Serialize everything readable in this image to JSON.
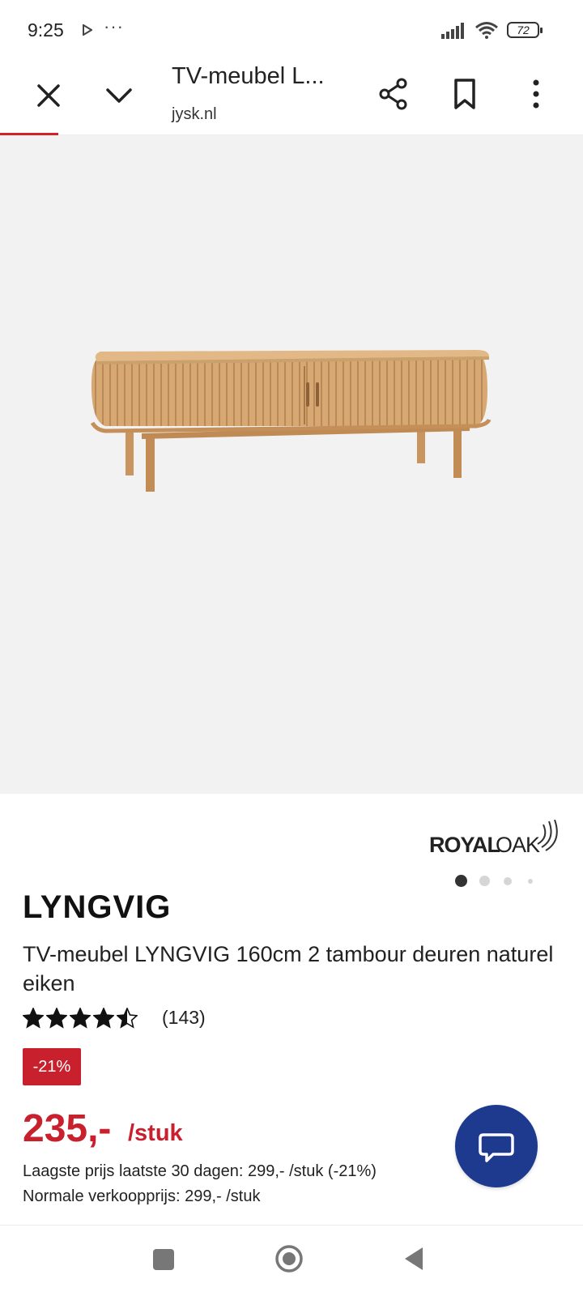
{
  "status_bar": {
    "time": "9:25",
    "overflow": "···",
    "battery": "72"
  },
  "browser": {
    "title": "TV-meubel L...",
    "domain": "jysk.nl",
    "icons": [
      "close-icon",
      "chevron-down-icon",
      "share-icon",
      "bookmark-icon",
      "more-vert-icon"
    ]
  },
  "product": {
    "brand_logo": "ROYAL OAK",
    "name": "LYNGVIG",
    "description": "TV-meubel LYNGVIG 160cm 2 tambour deuren naturel eiken",
    "rating": 4.5,
    "rating_max": 5,
    "rating_count": "(143)",
    "discount": "-21%",
    "price": "235,-",
    "price_unit": "/stuk",
    "lowest_price": "Laagste prijs laatste 30 dagen: 299,- /stuk (-21%)",
    "normal_price": "Normale verkoopprijs: 299,- /stuk",
    "carousel": {
      "count": 4,
      "active": 0
    }
  },
  "colors": {
    "accent_red": "#c8202d",
    "chat_blue": "#1d3a8f",
    "image_bg": "#f2f2f2"
  }
}
